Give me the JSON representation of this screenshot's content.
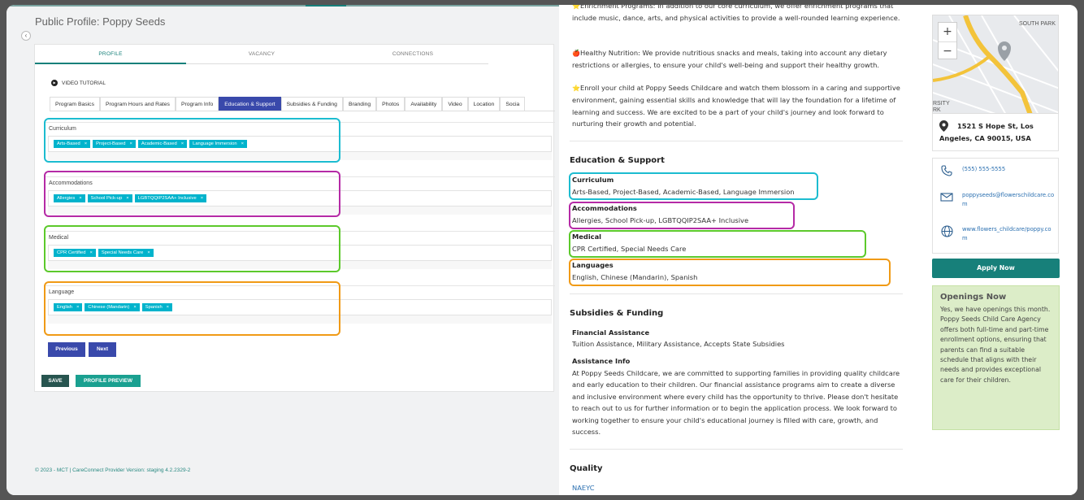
{
  "left": {
    "page_title": "Public Profile: Poppy Seeds",
    "collapse_glyph": "‹",
    "main_tabs": [
      {
        "label": "PROFILE",
        "active": true
      },
      {
        "label": "VACANCY",
        "active": false
      },
      {
        "label": "CONNECTIONS",
        "active": false
      }
    ],
    "video_tutorial": "VIDEO TUTORIAL",
    "sub_tabs": [
      {
        "label": "Program Basics",
        "active": false
      },
      {
        "label": "Program Hours and Rates",
        "active": false
      },
      {
        "label": "Program Info",
        "active": false
      },
      {
        "label": "Education & Support",
        "active": true
      },
      {
        "label": "Subsidies & Funding",
        "active": false
      },
      {
        "label": "Branding",
        "active": false
      },
      {
        "label": "Photos",
        "active": false
      },
      {
        "label": "Availability",
        "active": false
      },
      {
        "label": "Video",
        "active": false
      },
      {
        "label": "Location",
        "active": false
      },
      {
        "label": "Socia",
        "active": false
      }
    ],
    "fields": [
      {
        "label": "Curriculum",
        "chips": [
          "Arts-Based",
          "Project-Based",
          "Academic-Based",
          "Language Immersion"
        ]
      },
      {
        "label": "Accommodations",
        "chips": [
          "Allergies",
          "School Pick-up",
          "LGBTQQIP2SAA+ Inclusive"
        ]
      },
      {
        "label": "Medical",
        "chips": [
          "CPR Certified",
          "Special Needs Care"
        ]
      },
      {
        "label": "Language",
        "chips": [
          "English",
          "Chinese (Mandarin)",
          "Spanish"
        ]
      }
    ],
    "chip_remove": "×",
    "previous_label": "Previous",
    "next_label": "Next",
    "save_label": "SAVE",
    "preview_label": "PROFILE PREVIEW",
    "footer": "© 2023 - MCT | CareConnect Provider Version: staging 4.2.2329-2"
  },
  "mid": {
    "intro_partial": "Enrichment Programs: In addition to our core curriculum, we offer enrichment programs that include music, dance, arts, and physical activities to provide a well-rounded learning experience.",
    "nutrition": "Healthy Nutrition: We provide nutritious snacks and meals, taking into account any dietary restrictions or allergies, to ensure your child's well-being and support their healthy growth.",
    "enroll": "Enroll your child at Poppy Seeds Childcare and watch them blossom in a caring and supportive environment, gaining essential skills and knowledge that will lay the foundation for a lifetime of learning and success. We are excited to be a part of your child's journey and look forward to nurturing their growth and potential.",
    "emoji_enrich": "⭐",
    "emoji_nutrition": "🍎",
    "emoji_enroll": "⭐",
    "education_heading": "Education & Support",
    "curriculum_label": "Curriculum",
    "curriculum_value": "Arts-Based, Project-Based, Academic-Based, Language Immersion",
    "accommodations_label": "Accommodations",
    "accommodations_value": "Allergies, School Pick-up, LGBTQQIP2SAA+ Inclusive",
    "medical_label": "Medical",
    "medical_value": "CPR Certified, Special Needs Care",
    "languages_label": "Languages",
    "languages_value": "English, Chinese (Mandarin), Spanish",
    "subsidies_heading": "Subsidies & Funding",
    "financial_label": "Financial Assistance",
    "financial_value": "Tuition Assistance, Military Assistance, Accepts State Subsidies",
    "assistance_label": "Assistance Info",
    "assistance_value": "At Poppy Seeds Childcare, we are committed to supporting families in providing quality childcare and early education to their children. Our financial assistance programs aim to create a diverse and inclusive environment where every child has the opportunity to thrive. Please don't hesitate to reach out to us for further information or to begin the application process. We look forward to working together to ensure your child's educational journey is filled with care, growth, and success.",
    "quality_heading": "Quality",
    "quality_link": "NAEYC"
  },
  "right": {
    "map_labels": {
      "south_park": "SOUTH PARK",
      "rsity": "RSITY",
      "rk": "RK"
    },
    "zoom_in": "+",
    "zoom_out": "−",
    "address": "1521 S Hope St, Los Angeles, CA 90015, USA",
    "phone": "(555) 555-5555",
    "email": "poppyseeds@flowerschildcare.com",
    "website": "www.flowers_childcare/poppy.com",
    "apply_label": "Apply Now",
    "openings_title": "Openings Now",
    "openings_body": "Yes, we have openings this month.\nPoppy Seeds Child Care Agency offers both full-time and part-time enrollment options, ensuring that parents can find a suitable schedule that aligns with their needs and provides exceptional care for their children."
  },
  "colors": {
    "curriculum": "#1cbcd0",
    "accommodations": "#b52aa6",
    "medical": "#5cc92b",
    "language": "#f09a16",
    "teal": "#17807a",
    "indigo": "#3949ab",
    "chip": "#00b3cc"
  },
  "icons": {
    "phone": "phone-icon",
    "email": "email-icon",
    "website": "globe-icon",
    "address": "map-pin-icon",
    "video": "play-icon"
  }
}
